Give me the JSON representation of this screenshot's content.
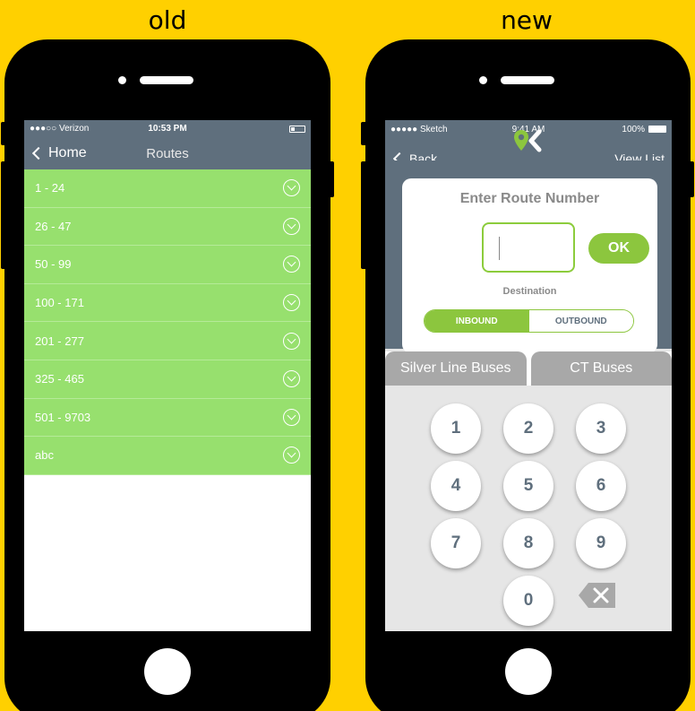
{
  "captions": {
    "old": "old",
    "new": "new"
  },
  "colors": {
    "background": "#FFD000",
    "nav": "#5f6f7d",
    "green_row": "#97e06e",
    "accent_green": "#8cc63e",
    "tab_gray": "#a8a8a8"
  },
  "old_screen": {
    "status": {
      "carrier": "●●●○○ Verizon",
      "time": "10:53 PM"
    },
    "nav": {
      "back_label": "Home",
      "title": "Routes"
    },
    "routes": [
      "1 - 24",
      "26 - 47",
      "50 - 99",
      "100 - 171",
      "201 - 277",
      "325 - 465",
      "501 - 9703",
      "abc"
    ]
  },
  "new_screen": {
    "status": {
      "carrier": "●●●●● Sketch",
      "time": "9:41 AM",
      "battery": "100%"
    },
    "nav": {
      "back_label": "Back",
      "view_list_label": "View List",
      "logo_icon": "location-pin-check-logo"
    },
    "card": {
      "title": "Enter Route Number",
      "input_value": "",
      "ok_label": "OK",
      "destination_label": "Destination",
      "segment": {
        "inbound": "INBOUND",
        "outbound": "OUTBOUND",
        "selected": "INBOUND"
      }
    },
    "tabs": [
      "Silver Line Buses",
      "CT Buses"
    ],
    "keys": [
      "1",
      "2",
      "3",
      "4",
      "5",
      "6",
      "7",
      "8",
      "9",
      "0"
    ],
    "backspace_icon": "backspace-icon"
  }
}
